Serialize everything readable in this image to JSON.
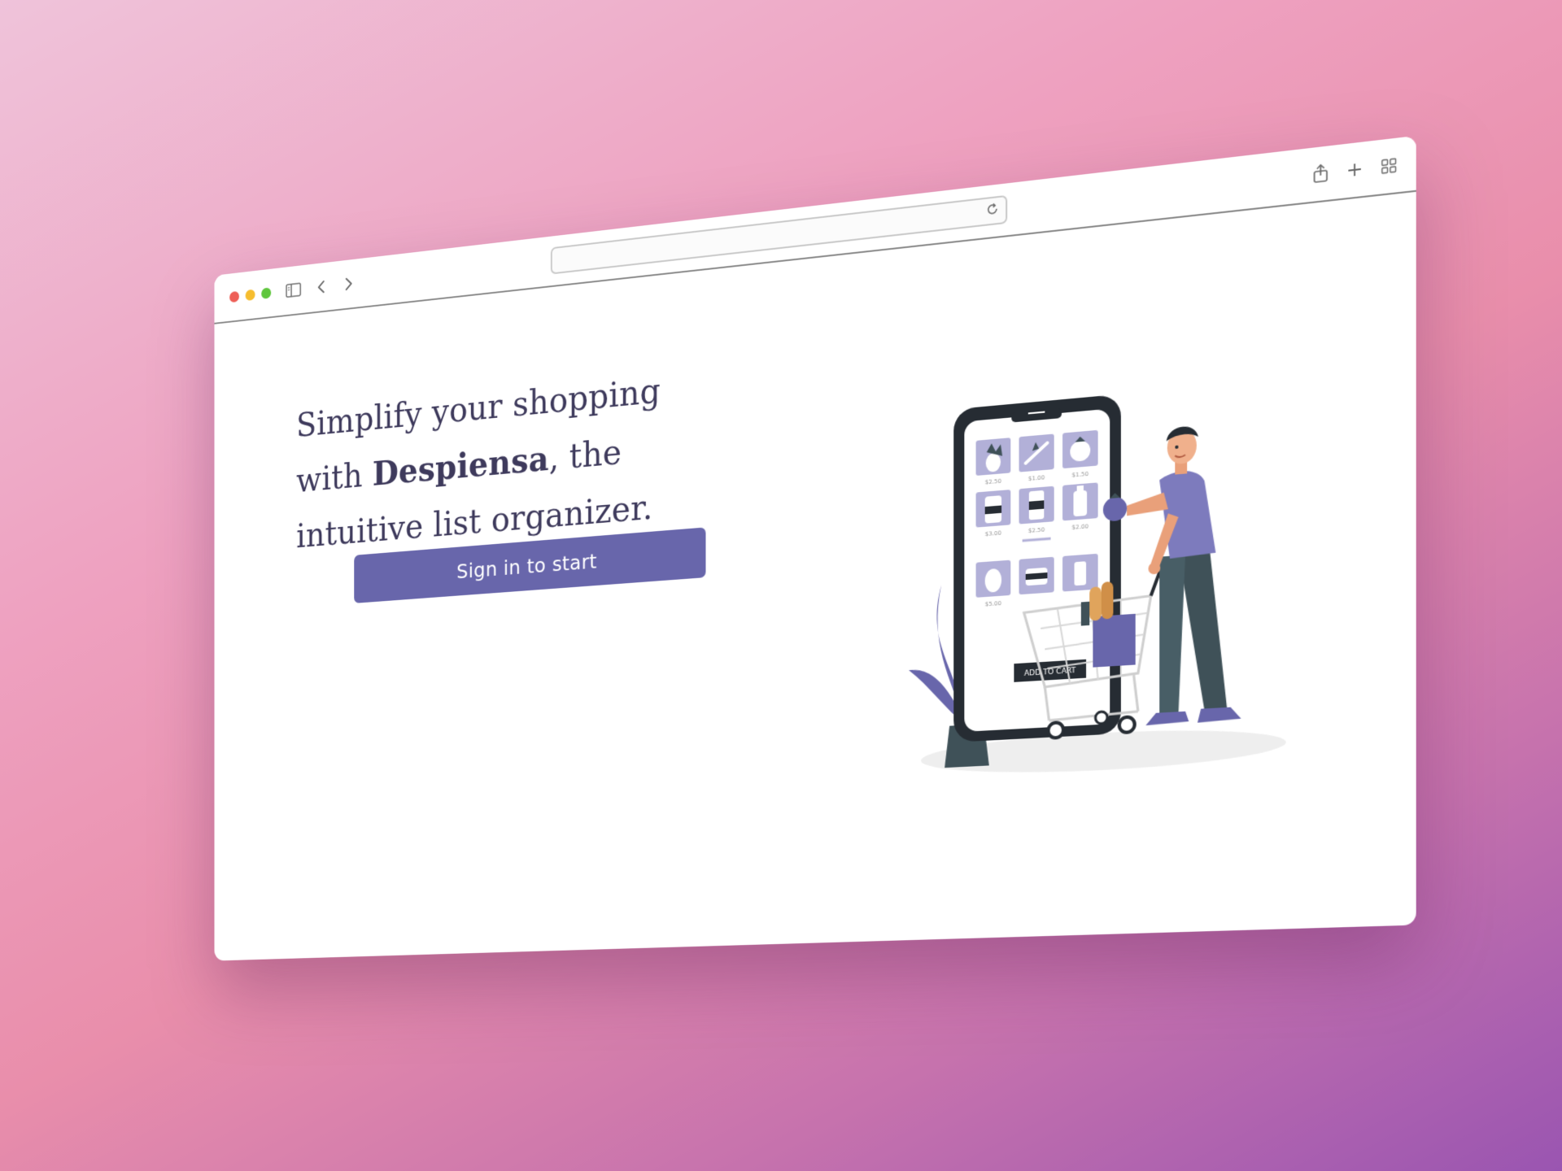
{
  "browser": {
    "toolbar": {
      "icons": [
        "sidebar-icon",
        "back-icon",
        "forward-icon",
        "reload-icon",
        "share-icon",
        "new-tab-icon",
        "tab-overview-icon"
      ],
      "address_value": ""
    }
  },
  "hero": {
    "headline_before": "Simplify your shopping with ",
    "brand": "Despiensa",
    "headline_after": ", the intuitive list organizer.",
    "cta_label": "Sign in to start"
  },
  "illustration": {
    "prices": [
      "$2.50",
      "$1.00",
      "$1.50",
      "$3.00",
      "$2.50",
      "$2.00",
      "$5.00"
    ],
    "add_to_cart_label": "ADD TO CART"
  },
  "colors": {
    "accent": "#6866ab",
    "heading": "#3e3a5c",
    "phone_frame": "#262c33",
    "tile": "#b2b0d8",
    "dark_slate": "#3f5158"
  }
}
